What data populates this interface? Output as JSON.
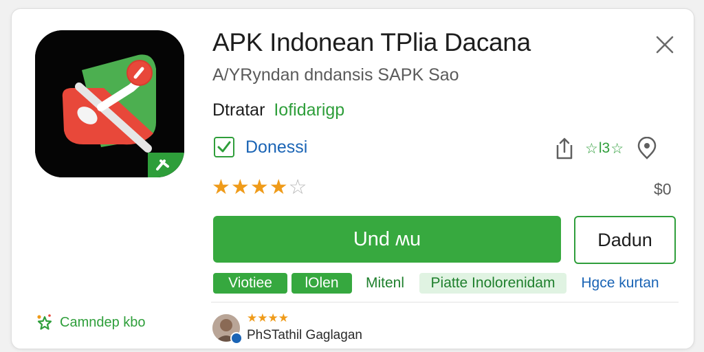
{
  "app": {
    "title": "APK Indonean TPlia Dacana",
    "subtitle": "A/YRyndan dndansis SAPK Sao",
    "developer_label": "Dtratar",
    "developer_name": "Iofidarigp",
    "icon": "map-pin-icon",
    "icon_colors": {
      "background": "#050505",
      "map_green": "#4caf50",
      "map_red": "#e8483a",
      "badge_green": "#2e9e3a"
    }
  },
  "checkbox": {
    "label": "Donessi",
    "checked": true
  },
  "actions": {
    "stars_badge_text": "l3",
    "share_icon": "share-icon",
    "pin_icon": "location-pin-icon"
  },
  "rating": {
    "stars": 4,
    "max_stars": 5
  },
  "price": "$0",
  "buttons": {
    "install": "Und ʍu",
    "secondary": "Dadun"
  },
  "tags": [
    {
      "label": "Viotiee",
      "style": "solid"
    },
    {
      "label": "lOlen",
      "style": "solid"
    },
    {
      "label": "Mitenl",
      "style": "plain"
    },
    {
      "label": "Piatte Inolorenidam",
      "style": "light"
    },
    {
      "label": "Hgce kurtan",
      "style": "blue"
    }
  ],
  "left_footer": {
    "label": "Camndep kbo",
    "icon": "sparkle-star-icon"
  },
  "review": {
    "stars": 4,
    "reviewer_name": "PhSTathil Gaglagan"
  },
  "colors": {
    "accent_green": "#37a93f",
    "link_blue": "#1a64b5",
    "star_orange": "#ef9b1a"
  }
}
